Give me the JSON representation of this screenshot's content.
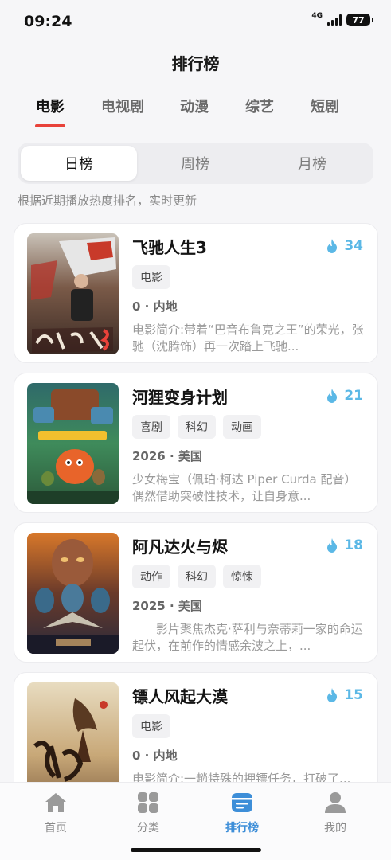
{
  "status_bar": {
    "time": "09:24",
    "network": "4G",
    "battery": "77"
  },
  "header": {
    "title": "排行榜"
  },
  "category_tabs": [
    {
      "label": "电影",
      "active": true
    },
    {
      "label": "电视剧",
      "active": false
    },
    {
      "label": "动漫",
      "active": false
    },
    {
      "label": "综艺",
      "active": false
    },
    {
      "label": "短剧",
      "active": false
    }
  ],
  "period_tabs": [
    {
      "label": "日榜",
      "active": true
    },
    {
      "label": "周榜",
      "active": false
    },
    {
      "label": "月榜",
      "active": false
    }
  ],
  "hint": "根据近期播放热度排名，实时更新",
  "colors": {
    "accent_red": "#e8423a",
    "heat_blue": "#5bb8e6",
    "active_tab_blue": "#3d8ed8"
  },
  "items": [
    {
      "title": "飞驰人生3",
      "heat": "34",
      "tags": [
        "电影"
      ],
      "meta": "0 · 内地",
      "description": "电影简介:带着“巴音布鲁克之王”的荣光，张驰（沈腾饰）再一次踏上飞驰..."
    },
    {
      "title": "河狸变身计划",
      "heat": "21",
      "tags": [
        "喜剧",
        "科幻",
        "动画"
      ],
      "meta": "2026 · 美国",
      "description": "少女梅宝（佩珀·柯达 Piper Curda 配音）偶然借助突破性技术，让自身意..."
    },
    {
      "title": "阿凡达火与烬",
      "heat": "18",
      "tags": [
        "动作",
        "科幻",
        "惊悚"
      ],
      "meta": "2025 · 美国",
      "description": "　　影片聚焦杰克·萨利与奈蒂莉一家的命运起伏，在前作的情感余波之上，..."
    },
    {
      "title": "镖人风起大漠",
      "heat": "15",
      "tags": [
        "电影"
      ],
      "meta": "0 · 内地",
      "description": "电影简介:一趟特殊的押镖任务，打破了..."
    }
  ],
  "bottom_tabs": [
    {
      "label": "首页",
      "icon": "home-icon",
      "active": false
    },
    {
      "label": "分类",
      "icon": "grid-icon",
      "active": false
    },
    {
      "label": "排行榜",
      "icon": "ranking-icon",
      "active": true
    },
    {
      "label": "我的",
      "icon": "user-icon",
      "active": false
    }
  ]
}
